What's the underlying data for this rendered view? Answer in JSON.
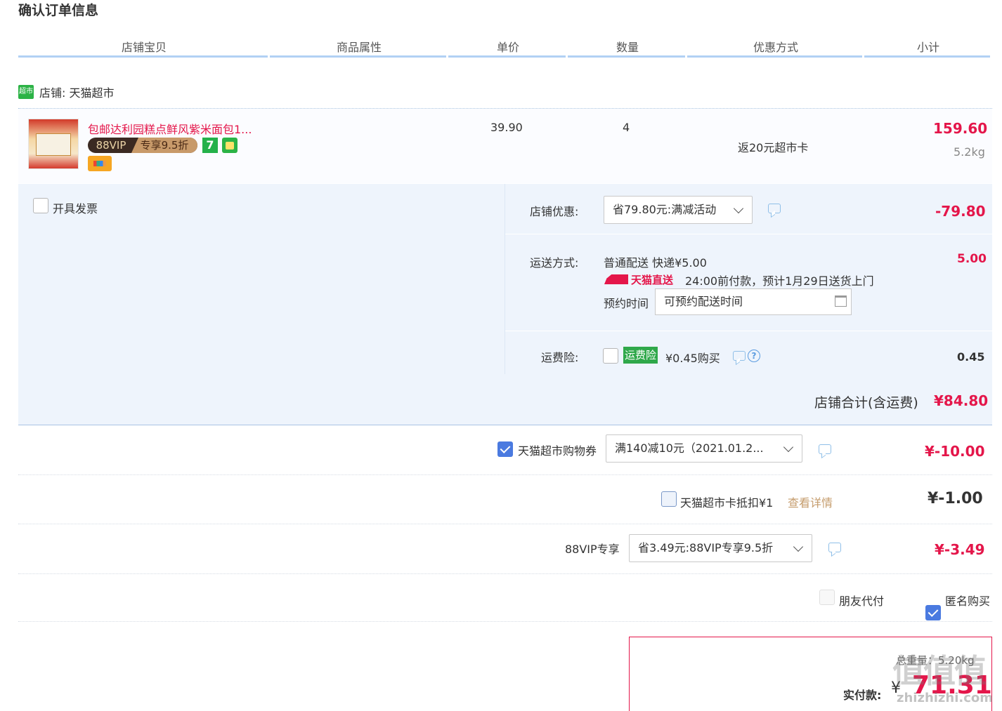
{
  "page_title": "确认订单信息",
  "columns": [
    "店铺宝贝",
    "商品属性",
    "单价",
    "数量",
    "优惠方式",
    "小计"
  ],
  "shop": {
    "logo_text": "超市",
    "label": "店铺: 天猫超市"
  },
  "item": {
    "title": "包邮达利园糕点鲜风紫米面包1...",
    "vip_badge_left": "88VIP",
    "vip_badge_right": "专享9.5折",
    "badge_7": "7",
    "price": "39.90",
    "quantity": "4",
    "promo": "返20元超市卡",
    "subtotal": "159.60",
    "weight": "5.2kg"
  },
  "invoice": {
    "label": "开具发票"
  },
  "store_discount": {
    "label": "店铺优惠:",
    "selected": "省79.80元:满减活动",
    "amount": "-79.80"
  },
  "shipping": {
    "label": "运送方式:",
    "method": "普通配送 快递¥5.00",
    "badge": "天猫直送",
    "note": "24:00前付款，预计1月29日送货上门",
    "appointment_label": "预约时间",
    "appointment_placeholder": "可预约配送时间",
    "amount": "5.00"
  },
  "insurance": {
    "label": "运费险:",
    "tag": "运费险",
    "price": "¥0.45购买",
    "help": "?",
    "amount": "0.45"
  },
  "shop_total": {
    "label": "店铺合计(含运费)",
    "amount": "¥84.80"
  },
  "coupon": {
    "label": "天猫超市购物券",
    "selected": "满140减10元（2021.01.2...",
    "amount": "¥-10.00"
  },
  "market_card": {
    "label": "天猫超市卡抵扣¥1",
    "link": "查看详情",
    "amount": "¥-1.00"
  },
  "vip": {
    "label": "88VIP专享",
    "selected": "省3.49元:88VIP专享9.5折",
    "amount": "¥-3.49"
  },
  "friend_pay": {
    "label": "朋友代付"
  },
  "anonymous": {
    "label": "匿名购买"
  },
  "payment": {
    "weight": "总重量：5.20kg",
    "label": "实付款:",
    "currency": "¥",
    "amount": "71.31",
    "watermark": "值值值",
    "watermark_sub": "zhizhizhi.com"
  },
  "colors": {
    "accent_red": "#e4164a",
    "header_line": "#b2d1f4",
    "panel_bg": "#eef4fc",
    "tmall_green": "#2cb346"
  }
}
